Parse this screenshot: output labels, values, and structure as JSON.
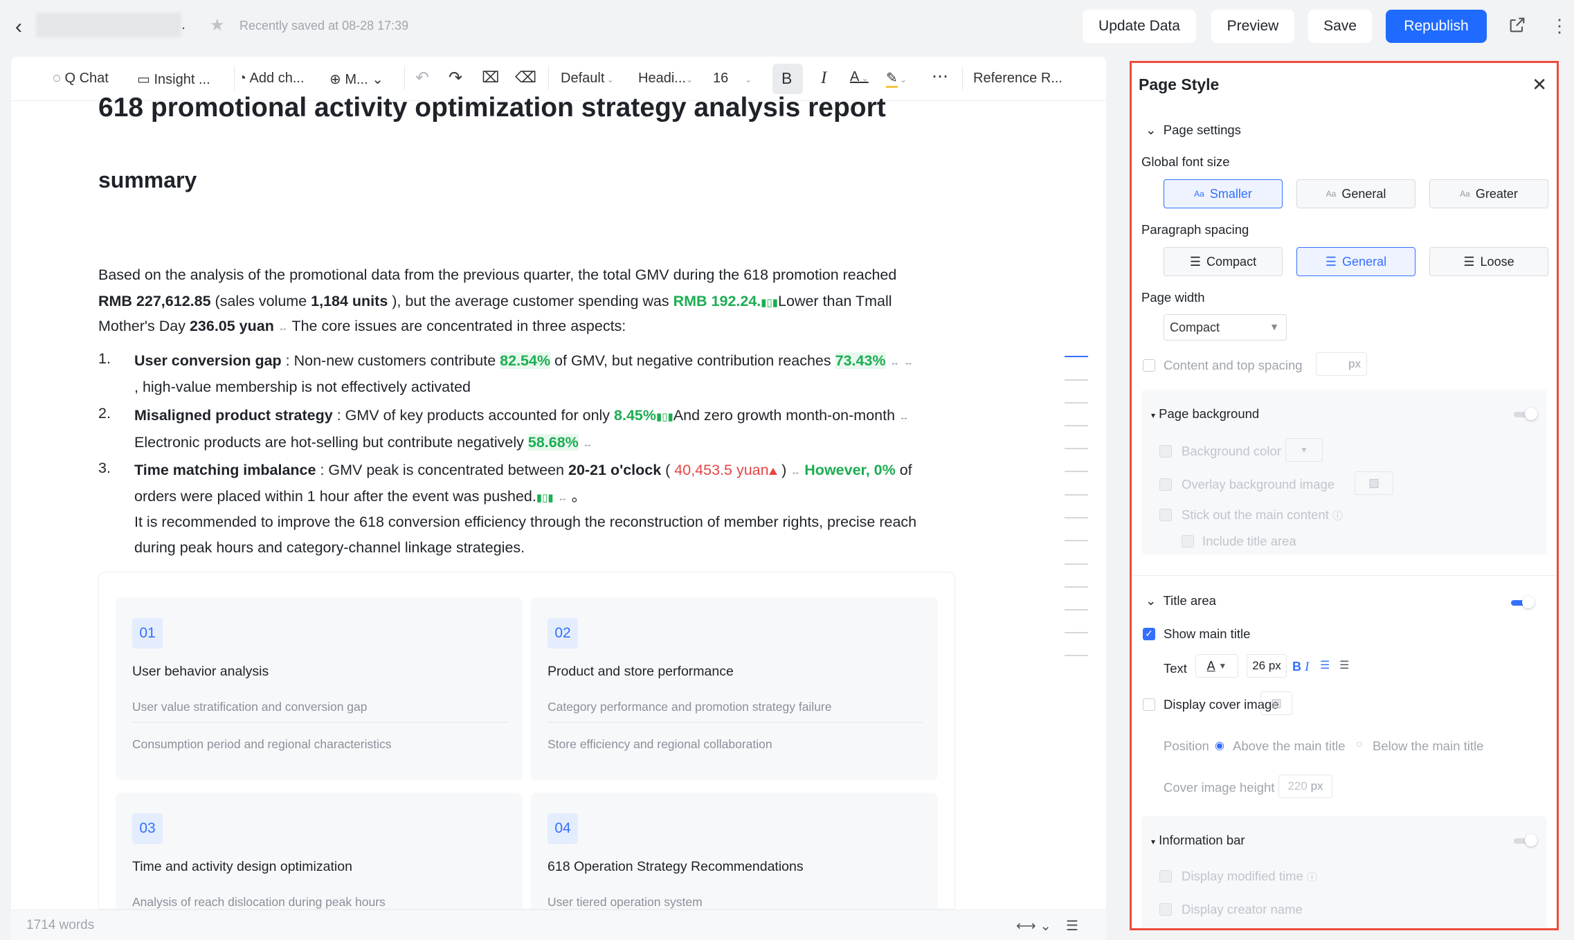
{
  "header": {
    "saved_text": "Recently saved at 08-28 17:39",
    "buttons": {
      "update": "Update Data",
      "preview": "Preview",
      "save": "Save",
      "republish": "Republish"
    }
  },
  "toolbar": {
    "chat": "Q Chat",
    "insight": "Insight ...",
    "add_chart": "Add ch...",
    "more": "M...",
    "style_default": "Default",
    "heading": "Headi...",
    "font_size": "16",
    "bold": "B",
    "italic": "I",
    "font_color": "A",
    "reference": "Reference R..."
  },
  "doc": {
    "title": "618 promotional activity optimization strategy analysis report",
    "summary_heading": "summary",
    "p1a": "Based on the analysis of the promotional data from the previous quarter, the total GMV during the 618 promotion reached",
    "p1b_rmb": "RMB 227,612.85",
    "p1b_mid": " (sales volume ",
    "p1b_units": "1,184 units",
    "p1b_mid2": " ), but the average customer spending was ",
    "p1b_green": "RMB 192.24.",
    "p1b_end": "Lower than Tmall",
    "p1c_start": "Mother's Day ",
    "p1c_bold": "236.05 yuan",
    "p1c_end": "The core issues are concentrated in three aspects:",
    "items": [
      {
        "num": "1.",
        "bold": "User conversion gap",
        "t1": " : Non-new customers contribute ",
        "g1": "82.54%",
        "t2": "  of GMV, but negative contribution reaches ",
        "g2": "73.43%",
        "line2": ", high-value membership is not effectively activated"
      },
      {
        "num": "2.",
        "bold": "Misaligned product strategy",
        "t1": " : GMV of key products accounted for only ",
        "g1": "8.45%",
        "t2": "And zero growth month-on-month",
        "line2": "Electronic products are hot-selling but contribute negatively ",
        "g2": "58.68%"
      },
      {
        "num": "3.",
        "bold": "Time matching imbalance",
        "t1": " : GMV peak is concentrated between ",
        "b2": "20-21 o'clock",
        "t2": " ( ",
        "r1": "40,453.5 yuan",
        "t3": " )  ",
        "g1": "However, 0%",
        "t4": " of",
        "line2": "orders were placed within 1 hour after the event was pushed.",
        "line2end": " 。",
        "line3": "It is recommended to improve the 618 conversion efficiency through the reconstruction of member rights, precise reach",
        "line4": "during peak hours and category-channel linkage strategies."
      }
    ],
    "cards": [
      {
        "num": "01",
        "title": "User behavior analysis",
        "items": [
          "User value stratification and conversion gap",
          "Consumption period and regional characteristics"
        ]
      },
      {
        "num": "02",
        "title": "Product and store performance",
        "items": [
          "Category performance and promotion strategy failure",
          "Store efficiency and regional collaboration"
        ]
      },
      {
        "num": "03",
        "title": "Time and activity design optimization",
        "items": [
          "Analysis of reach dislocation during peak hours"
        ]
      },
      {
        "num": "04",
        "title": "618 Operation Strategy Recommendations",
        "items": [
          "User tiered operation system"
        ]
      }
    ],
    "word_count": "1714 words"
  },
  "panel": {
    "title": "Page Style",
    "page_settings": "Page settings",
    "global_font_size": "Global font size",
    "font_sizes": [
      "Smaller",
      "General",
      "Greater"
    ],
    "font_size_icon": "Aa",
    "paragraph_spacing": "Paragraph spacing",
    "spacings": [
      "Compact",
      "General",
      "Loose"
    ],
    "page_width": "Page width",
    "page_width_value": "Compact",
    "content_top_spacing": "Content and top spacing",
    "px": "px",
    "page_background": "Page background",
    "background_color": "Background color",
    "overlay_image": "Overlay background image",
    "stick_out": "Stick out the main content",
    "include_title": "Include title area",
    "title_area": "Title area",
    "show_main_title": "Show main title",
    "text_label": "Text",
    "title_font_size": "26",
    "display_cover": "Display cover image",
    "position": "Position",
    "above": "Above the main title",
    "below": "Below the main title",
    "cover_height": "Cover image height",
    "cover_height_value": "220",
    "information_bar": "Information bar",
    "display_modified": "Display modified time",
    "display_creator": "Display creator name"
  },
  "colors": {
    "accent": "#3370ff",
    "positive": "#1dad52",
    "negative": "#e54545",
    "highlight_border": "#ee4b3b"
  }
}
